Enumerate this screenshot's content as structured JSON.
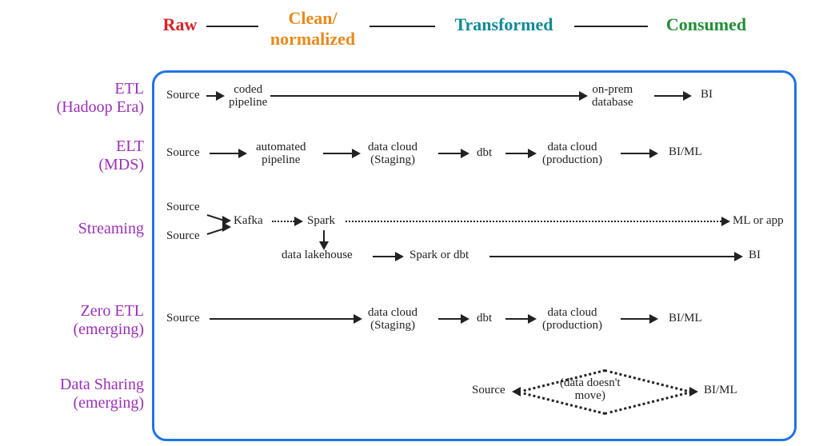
{
  "headers": {
    "raw": "Raw",
    "clean": "Clean/\nnormalized",
    "transformed": "Transformed",
    "consumed": "Consumed"
  },
  "rows": {
    "etl": "ETL\n(Hadoop Era)",
    "elt": "ELT\n(MDS)",
    "stream": "Streaming",
    "zero": "Zero ETL\n(emerging)",
    "share": "Data Sharing\n(emerging)"
  },
  "nodes": {
    "etl_source": "Source",
    "etl_coded": "coded\npipeline",
    "etl_db": "on-prem\ndatabase",
    "etl_bi": "BI",
    "elt_source": "Source",
    "elt_auto": "automated\npipeline",
    "elt_stage": "data cloud\n(Staging)",
    "elt_dbt": "dbt",
    "elt_prod": "data cloud\n(production)",
    "elt_bi": "BI/ML",
    "str_src1": "Source",
    "str_src2": "Source",
    "str_kafka": "Kafka",
    "str_spark": "Spark",
    "str_lake": "data lakehouse",
    "str_sdbt": "Spark or dbt",
    "str_ml": "ML or app",
    "str_bi": "BI",
    "z_source": "Source",
    "z_stage": "data cloud\n(Staging)",
    "z_dbt": "dbt",
    "z_prod": "data cloud\n(production)",
    "z_bi": "BI/ML",
    "sh_source": "Source",
    "sh_note": "(data doesn't\nmove)",
    "sh_bi": "BI/ML"
  },
  "colors": {
    "raw": "#d62324",
    "clean": "#e88a1a",
    "transformed": "#0f8a94",
    "consumed": "#1f8f34",
    "row": "#9b2fb8",
    "line": "#222",
    "border": "#1e73e8"
  }
}
